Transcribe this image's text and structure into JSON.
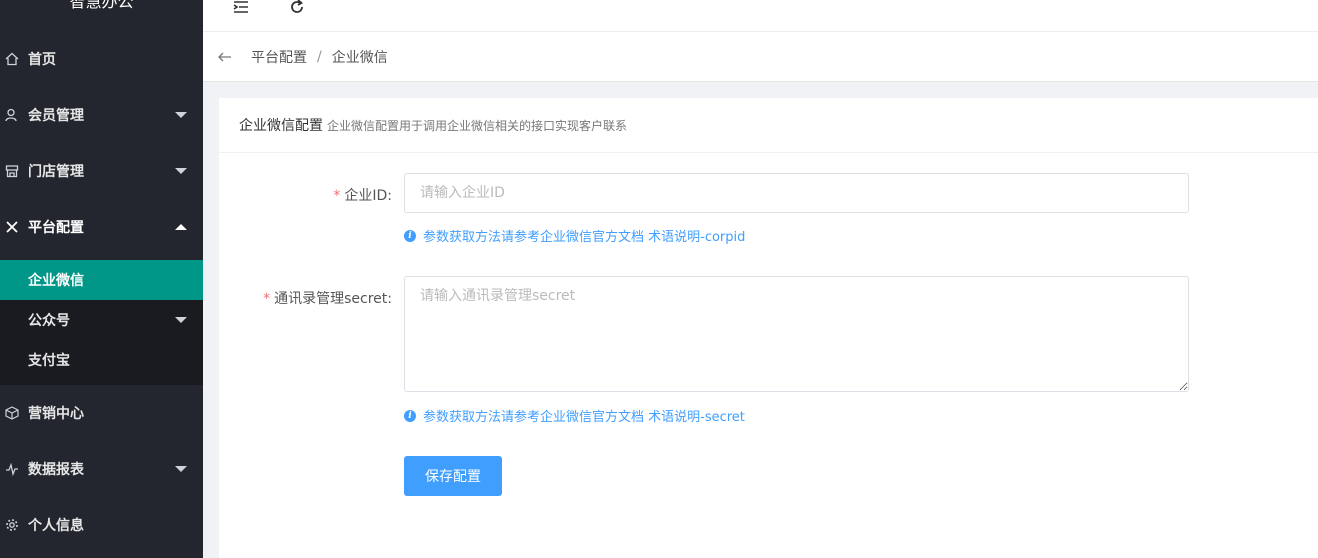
{
  "app": {
    "brand": "智慧办公"
  },
  "sidebar": {
    "items": [
      {
        "label": "首页",
        "icon": "home-icon"
      },
      {
        "label": "会员管理",
        "icon": "user-icon"
      },
      {
        "label": "门店管理",
        "icon": "store-icon"
      },
      {
        "label": "平台配置",
        "icon": "tools-icon"
      },
      {
        "label": "营销中心",
        "icon": "cube-icon"
      },
      {
        "label": "数据报表",
        "icon": "pulse-icon"
      },
      {
        "label": "个人信息",
        "icon": "gear-icon"
      }
    ],
    "submenu": [
      {
        "label": "企业微信",
        "active": true
      },
      {
        "label": "公众号"
      },
      {
        "label": "支付宝"
      }
    ],
    "active_color": "#009688"
  },
  "topbar": {
    "icons": [
      "menu-toggle-icon",
      "refresh-icon"
    ]
  },
  "breadcrumb": {
    "parent": "平台配置",
    "separator": "/",
    "current": "企业微信"
  },
  "card": {
    "title": "企业微信配置",
    "description": "企业微信配置用于调用企业微信相关的接口实现客户联系"
  },
  "form": {
    "corpid": {
      "required_mark": "*",
      "label": "企业ID:",
      "placeholder": "请输入企业ID",
      "value": "",
      "hint": "参数获取方法请参考企业微信官方文档 术语说明-corpid"
    },
    "secret": {
      "required_mark": "*",
      "label": "通讯录管理secret:",
      "placeholder": "请输入通讯录管理secret",
      "value": "",
      "hint": "参数获取方法请参考企业微信官方文档 术语说明-secret"
    },
    "save_label": "保存配置",
    "accent_color": "#409eff"
  }
}
